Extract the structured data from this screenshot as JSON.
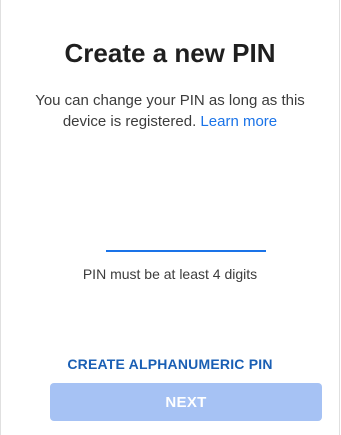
{
  "header": {
    "title": "Create a new PIN",
    "description": "You can change your PIN as long as this device is registered.",
    "learn_more_link": "Learn more"
  },
  "pin_input": {
    "value": "",
    "hint": "PIN must be at least 4 digits"
  },
  "actions": {
    "alphanumeric_label": "CREATE ALPHANUMERIC PIN",
    "next_label": "NEXT",
    "next_enabled": false
  },
  "colors": {
    "accent": "#1a73e8",
    "next_disabled_bg": "#a6c2f4"
  }
}
